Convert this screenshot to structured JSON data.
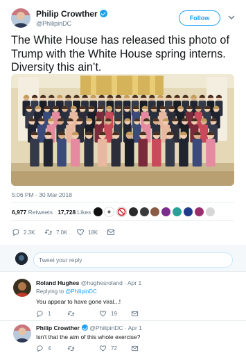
{
  "tweet": {
    "author_name": "Philip Crowther",
    "author_handle": "@PhilipinDC",
    "follow_label": "Follow",
    "text": "The White House has released this photo of Trump with the White House spring interns. Diversity this ain’t.",
    "timestamp": "5:06 PM - 30 Mar 2018",
    "retweets_count": "6,977",
    "retweets_label": "Retweets",
    "likes_count": "17,728",
    "likes_label": "Likes",
    "actions": {
      "replies": "2.3K",
      "retweets": "7.0K",
      "likes": "18K"
    }
  },
  "reply_box": {
    "placeholder": "Tweet your reply"
  },
  "replies": [
    {
      "name": "Roland Hughes",
      "handle": "@hughesroland",
      "date": "· Apr 1",
      "replying_prefix": "Replying to",
      "replying_to": "@PhilipinDC",
      "text": "You appear to have gone viral...!",
      "actions": {
        "replies": "1",
        "retweets": "",
        "likes": "19"
      }
    },
    {
      "name": "Philip Crowther",
      "handle": "@PhilipinDC",
      "date": "· Apr 1",
      "text": "Isn't that the aim of this whole exercise?",
      "actions": {
        "replies": "4",
        "retweets": "",
        "likes": "72"
      }
    }
  ],
  "colors": {
    "accent": "#1da1f2",
    "muted": "#657786",
    "like_red": "#e0245e"
  }
}
